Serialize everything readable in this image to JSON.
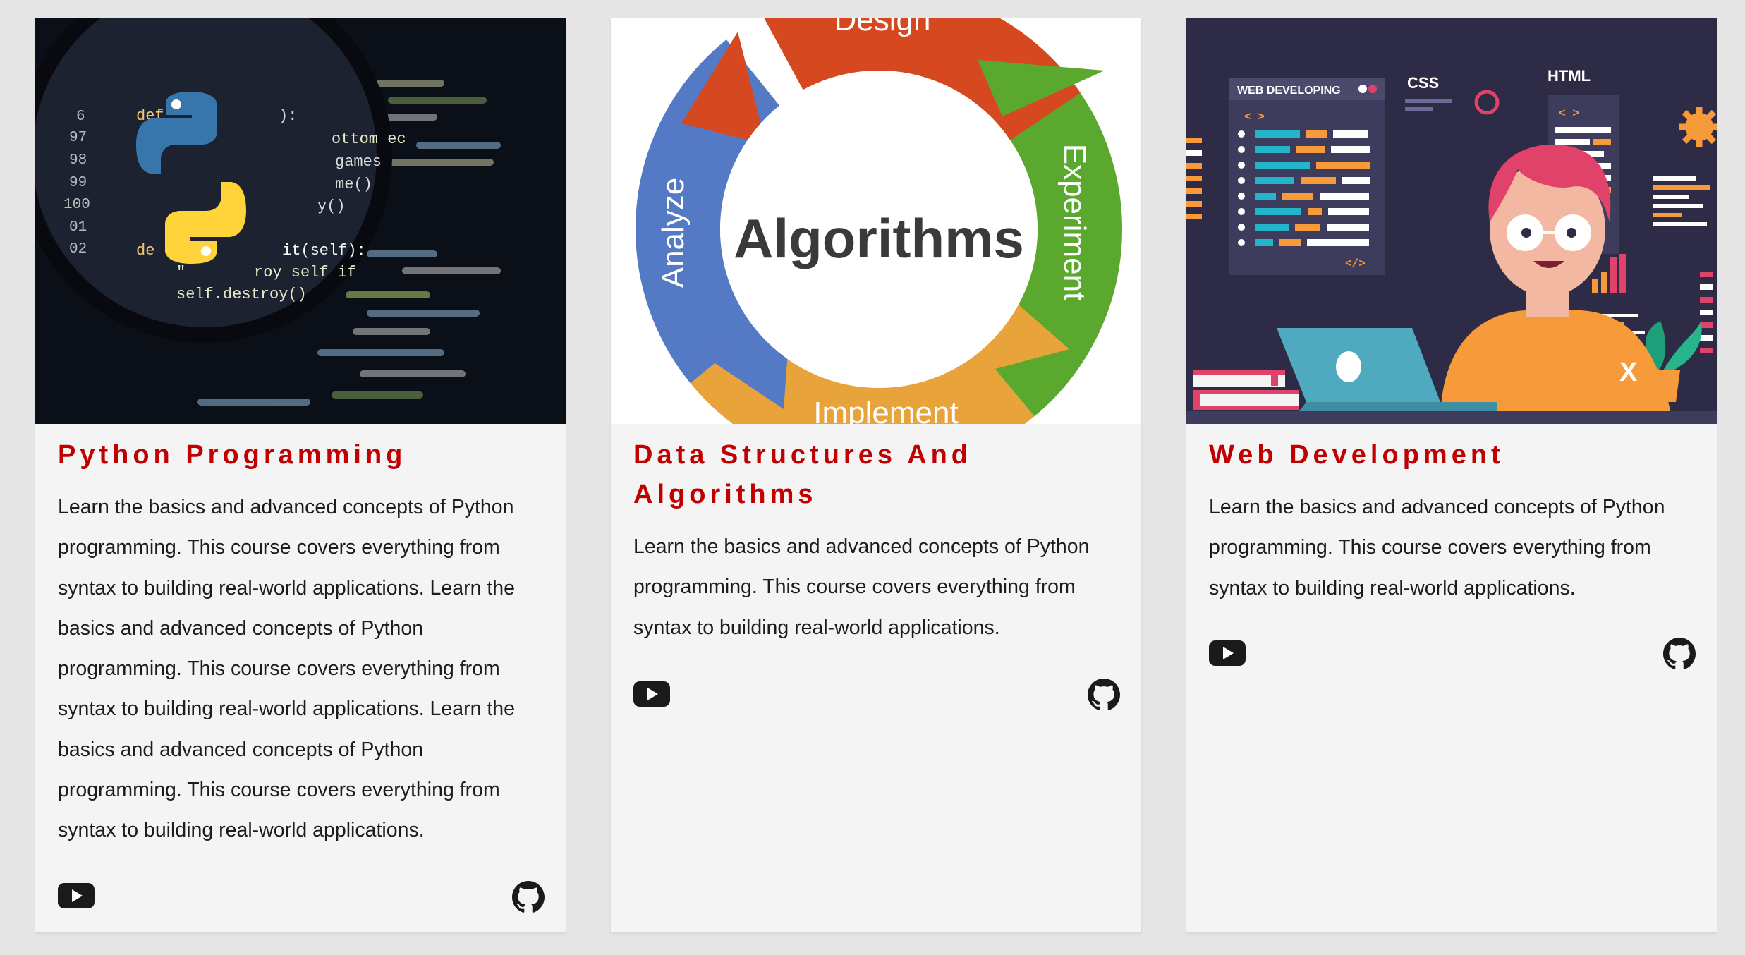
{
  "courses": [
    {
      "title": "Python Programming",
      "image": "python-logo-over-code",
      "description": "Learn the basics and advanced concepts of Python programming. This course covers everything from syntax to building real-world applications. Learn the basics and advanced concepts of Python programming. This course covers everything from syntax to building real-world applications. Learn the basics and advanced concepts of Python programming. This course covers everything from syntax to building real-world applications.",
      "icons": [
        "youtube-icon",
        "github-icon"
      ]
    },
    {
      "title": "Data Structures And Algorithms",
      "image": "algorithms-cycle",
      "image_text": {
        "center": "Algorithms",
        "top": "Design",
        "right": "Experiment",
        "bottom": "Implement",
        "left": "Analyze"
      },
      "description": "Learn the basics and advanced concepts of Python programming. This course covers everything from syntax to building real-world applications.",
      "icons": [
        "youtube-icon",
        "github-icon"
      ]
    },
    {
      "title": "Web Development",
      "image": "web-developer-illustration",
      "image_text": {
        "panel": "WEB DEVELOPING",
        "css": "CSS",
        "html": "HTML",
        "tag_open": "< >",
        "tag_close": "</>",
        "shirt": "X"
      },
      "description": "Learn the basics and advanced concepts of Python programming. This course covers everything from syntax to building real-world applications.",
      "icons": [
        "youtube-icon",
        "github-icon"
      ]
    }
  ],
  "colors": {
    "page_bg": "#e6e6e6",
    "card_bg": "#f4f4f4",
    "title": "#c00000",
    "text": "#1c1c1c",
    "icon": "#1a1a1a"
  }
}
